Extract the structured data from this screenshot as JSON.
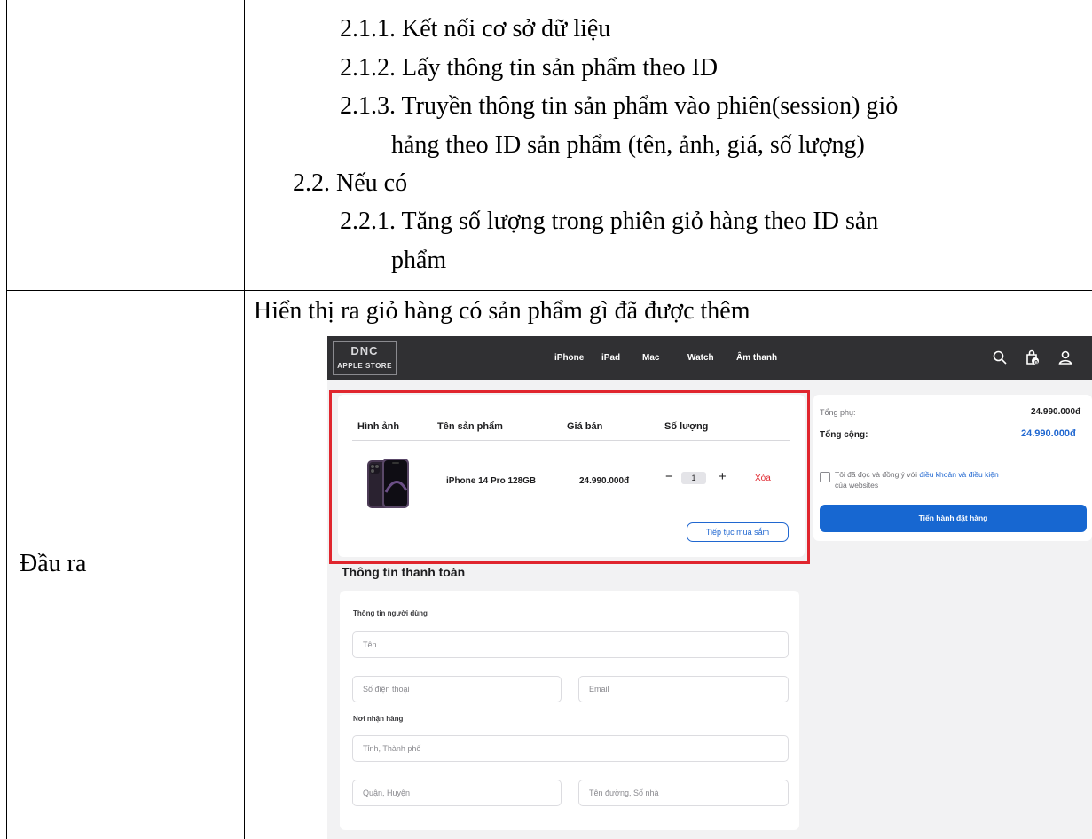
{
  "document": {
    "outline_lines": [
      "2.1.1.  Kết nối cơ sở dữ liệu",
      "2.1.2.  Lấy thông tin sản phẩm theo ID",
      "2.1.3.  Truyền thông tin sản phẩm vào phiên(session) giỏ",
      "hảng theo ID sản phẩm (tên, ảnh, giá, số lượng)",
      "2.2. Nếu có",
      "2.2.1.  Tăng số lượng trong phiên giỏ hàng theo ID sản",
      "phẩm"
    ],
    "output_label": "Đầu ra",
    "output_description": "Hiển thị ra giỏ hàng có sản phẩm gì đã được thêm"
  },
  "store": {
    "logo_mark": "DNC",
    "logo_text": "APPLE STORE",
    "nav": [
      "iPhone",
      "iPad",
      "Mac",
      "Watch",
      "Âm thanh"
    ],
    "icons": [
      "search-icon",
      "shopping-bag-icon",
      "user-icon"
    ],
    "cart_badge": "0",
    "cart": {
      "headers": [
        "Hình ảnh",
        "Tên sản phẩm",
        "Giá bán",
        "Số lượng"
      ],
      "item": {
        "name": "iPhone 14 Pro 128GB",
        "price": "24.990.000đ",
        "minus": "−",
        "quantity": "1",
        "plus": "+",
        "delete": "Xóa"
      },
      "continue_label": "Tiếp tục mua sắm"
    },
    "summary": {
      "subtotal_label": "Tổng phụ:",
      "subtotal_value": "24.990.000đ",
      "total_label": "Tổng cộng:",
      "total_value": "24.990.000đ",
      "terms_prefix": "Tôi đã đọc và đồng ý với ",
      "terms_link": "điều khoản và điều kiện",
      "terms_suffix": " của websites",
      "order_button": "Tiến hành đặt hàng"
    },
    "payment": {
      "title": "Thông tin thanh toán",
      "user_section": "Thông tin người dùng",
      "name_placeholder": "Tên",
      "phone_placeholder": "Số điện thoại",
      "email_placeholder": "Email",
      "address_section": "Nơi nhận hàng",
      "city_placeholder": "Tỉnh, Thành phố",
      "district_placeholder": "Quận, Huyện",
      "street_placeholder": "Tên đường, Số nhà"
    },
    "colors": {
      "header_bg": "#303033",
      "accent_blue": "#1767d1",
      "highlight_red": "#e0262e",
      "page_bg": "#f2f2f3"
    }
  }
}
